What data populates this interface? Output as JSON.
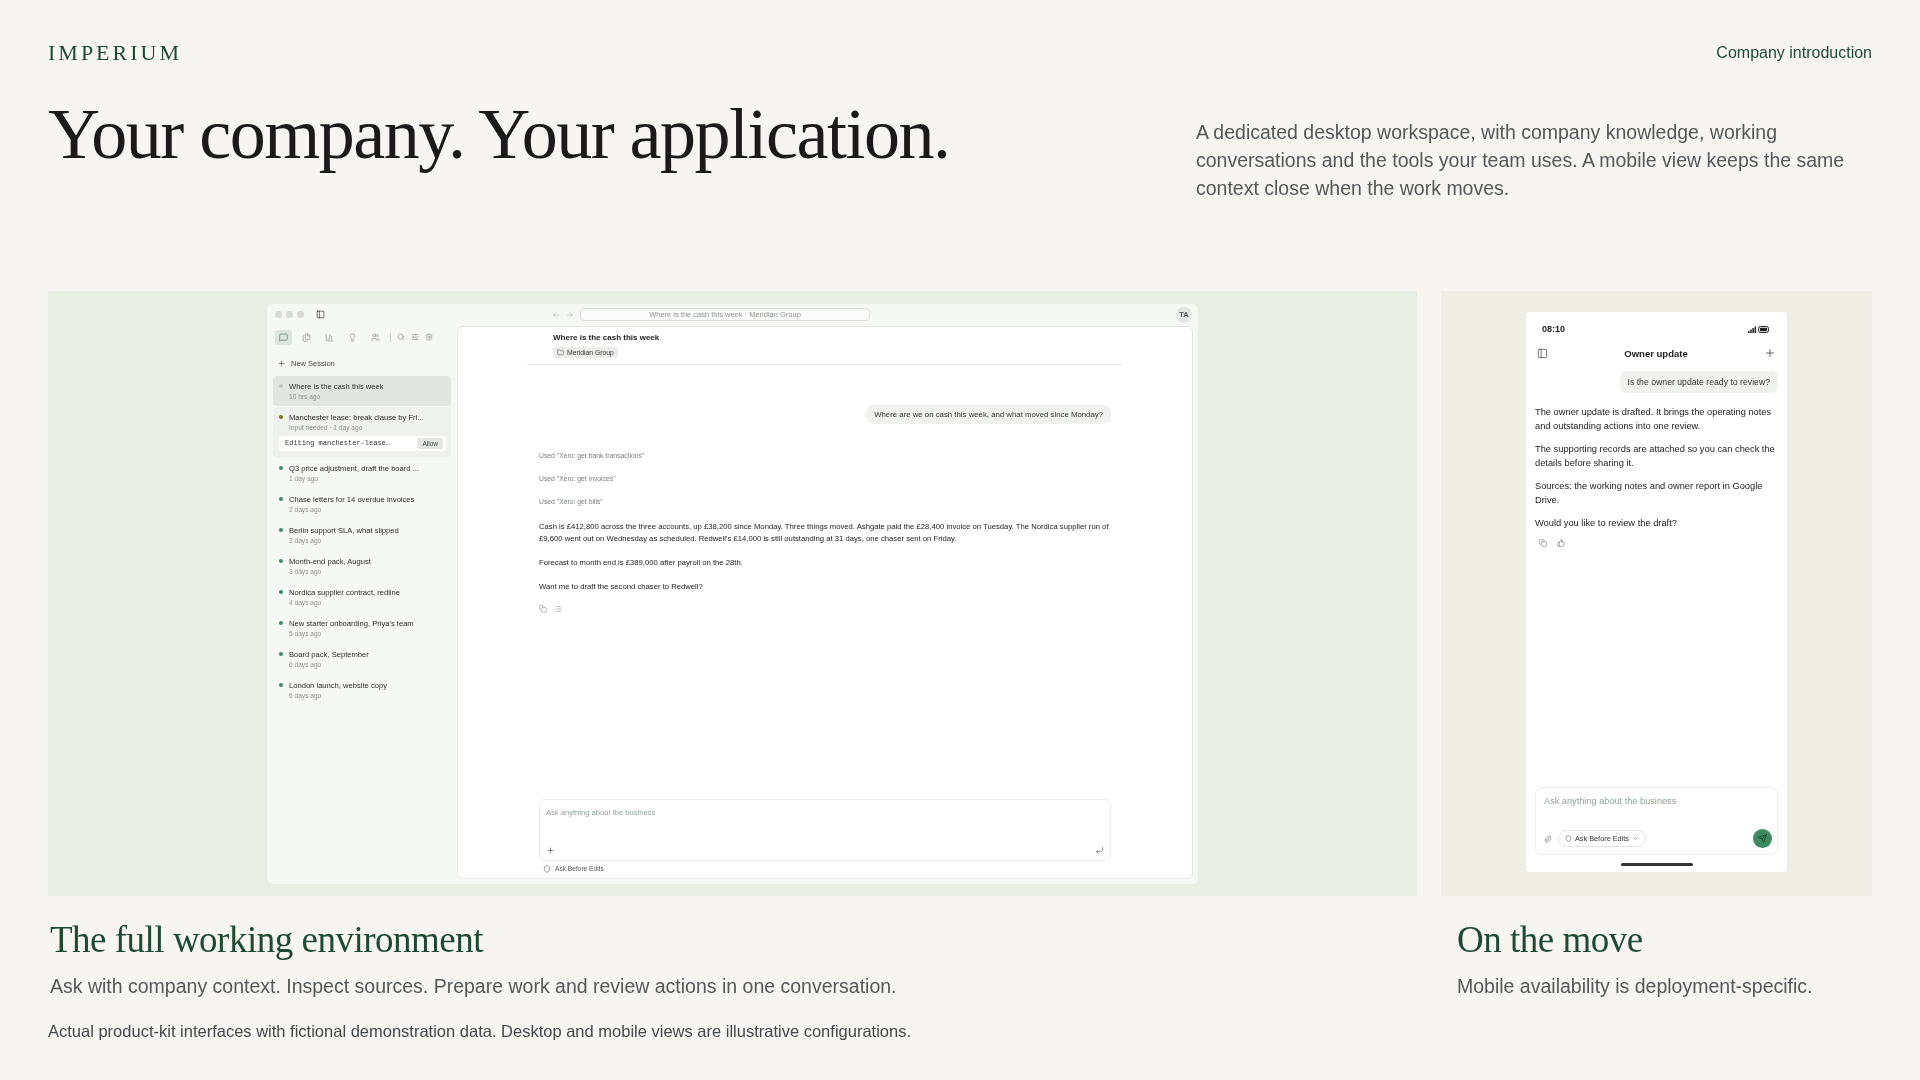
{
  "header": {
    "logo": "IMPERIUM",
    "link": "Company introduction"
  },
  "hero": {
    "title": "Your company. Your application.",
    "description": "A dedicated desktop workspace, with company knowledge, working conversations and the tools your team uses. A mobile view keeps the same context close when the work moves."
  },
  "desktop": {
    "address": "Where is the cash this week · Meridian Group",
    "avatar": "TA",
    "new_session": "New Session",
    "nav": [
      {
        "kind": "chat",
        "selected": true
      },
      {
        "kind": "files",
        "selected": false
      },
      {
        "kind": "chart",
        "selected": false
      },
      {
        "kind": "bulb",
        "selected": false
      },
      {
        "kind": "team",
        "selected": false
      }
    ],
    "sessions": [
      {
        "title": "Where is the cash this week",
        "time": "10 hrs ago",
        "color": "#c2c7c2",
        "selected": true
      },
      {
        "title": "Manchester lease: break clause by Fri...",
        "time": "Input needed · 1 day ago",
        "color": "#7d7a1c",
        "selected": false,
        "approval": {
          "command": "Editing manchester-lease…",
          "button": "Allow"
        }
      },
      {
        "title": "Q3 price adjustment, draft the board ...",
        "time": "1 day ago",
        "color": "#3f8a5f",
        "selected": false
      },
      {
        "title": "Chase letters for 14 overdue invoices",
        "time": "2 days ago",
        "color": "#3f8a5f",
        "selected": false
      },
      {
        "title": "Berlin support SLA, what slipped",
        "time": "2 days ago",
        "color": "#3f8a5f",
        "selected": false
      },
      {
        "title": "Month-end pack, August",
        "time": "3 days ago",
        "color": "#3f8a5f",
        "selected": false
      },
      {
        "title": "Nordica supplier contract, redline",
        "time": "4 days ago",
        "color": "#3f8a5f",
        "selected": false
      },
      {
        "title": "New starter onboarding, Priya's team",
        "time": "5 days ago",
        "color": "#3f8a5f",
        "selected": false
      },
      {
        "title": "Board pack, September",
        "time": "6 days ago",
        "color": "#3f8a5f",
        "selected": false
      },
      {
        "title": "London launch, website copy",
        "time": "6 days ago",
        "color": "#3f8a5f",
        "selected": false
      }
    ],
    "chat": {
      "title": "Where is the cash this week",
      "tag": "Meridian Group",
      "user_message": "Where are we on cash this week, and what moved since Monday?",
      "tool_calls": [
        "Used \"Xero: get bank transactions\"",
        "Used \"Xero: get invoices\"",
        "Used \"Xero: get bills\""
      ],
      "reply": [
        "Cash is £412,800 across the three accounts, up £38,200 since Monday. Three things moved. Ashgate paid the £28,400 invoice on Tuesday. The Nordica supplier run of £9,600 went out on Wednesday as scheduled. Redwell's £14,000 is still outstanding at 31 days, one chaser sent on Friday.",
        "Forecast to month end is £389,000 after payroll on the 28th.",
        "Want me to draft the second chaser to Redwell?"
      ],
      "placeholder": "Ask anything about the business",
      "mode": "Ask Before Edits"
    }
  },
  "mobile": {
    "time": "08:10",
    "title": "Owner update",
    "user_message": "Is the owner update ready to review?",
    "reply": [
      "The owner update is drafted. It brings the operating notes and outstanding actions into one review.",
      "The supporting records are attached so you can check the details before sharing it.",
      "Sources: the working notes and owner report in Google Drive.",
      "Would you like to review the draft?"
    ],
    "placeholder": "Ask anything about the business",
    "mode": "Ask Before Edits"
  },
  "sections": [
    {
      "title": "The full working environment",
      "text": "Ask with company context. Inspect sources. Prepare work and review actions in one conversation."
    },
    {
      "title": "On the move",
      "text": "Mobile availability is deployment-specific."
    }
  ],
  "footnote": "Actual product-kit interfaces with fictional demonstration data. Desktop and mobile views are illustrative configurations."
}
